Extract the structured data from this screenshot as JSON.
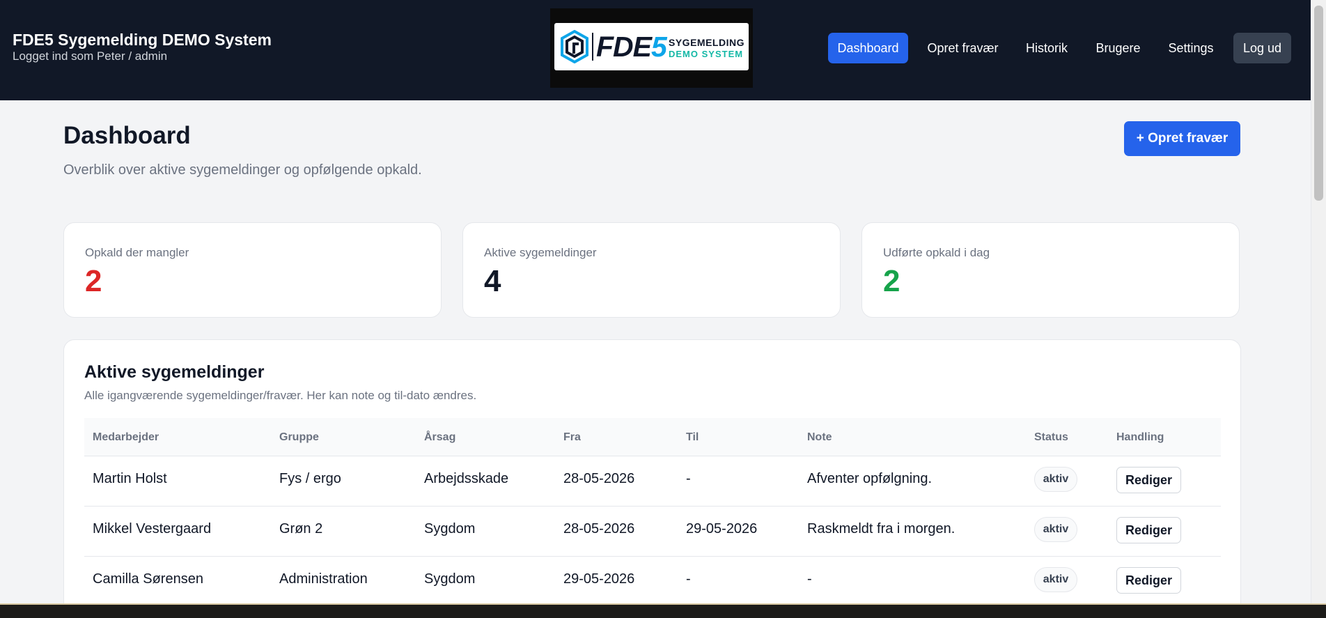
{
  "header": {
    "app_title": "FDE5 Sygemelding DEMO System",
    "logged_in_as": "Logget ind som Peter / admin",
    "logo": {
      "fde": "FDE",
      "five": "5",
      "line1": "SYGEMELDING",
      "line2": "DEMO SYSTEM"
    },
    "nav": [
      {
        "label": "Dashboard",
        "active": true
      },
      {
        "label": "Opret fravær"
      },
      {
        "label": "Historik"
      },
      {
        "label": "Brugere"
      },
      {
        "label": "Settings"
      },
      {
        "label": "Log ud"
      }
    ]
  },
  "page": {
    "title": "Dashboard",
    "subtitle": "Overblik over aktive sygemeldinger og opfølgende opkald.",
    "create_button": "+ Opret fravær"
  },
  "stats": [
    {
      "label": "Opkald der mangler",
      "value": "2",
      "color": "#dc2626"
    },
    {
      "label": "Aktive sygemeldinger",
      "value": "4",
      "color": "#111827"
    },
    {
      "label": "Udførte opkald i dag",
      "value": "2",
      "color": "#16a34a"
    }
  ],
  "panel": {
    "title": "Aktive sygemeldinger",
    "subtitle": "Alle igangværende sygemeldinger/fravær. Her kan note og til-dato ændres.",
    "columns": [
      "Medarbejder",
      "Gruppe",
      "Årsag",
      "Fra",
      "Til",
      "Note",
      "Status",
      "Handling"
    ],
    "rows": [
      {
        "medarbejder": "Martin Holst",
        "gruppe": "Fys / ergo",
        "aarsag": "Arbejdsskade",
        "fra": "28-05-2026",
        "til": "-",
        "note": "Afventer opfølgning.",
        "status": "aktiv",
        "action": "Rediger"
      },
      {
        "medarbejder": "Mikkel Vestergaard",
        "gruppe": "Grøn 2",
        "aarsag": "Sygdom",
        "fra": "28-05-2026",
        "til": "29-05-2026",
        "note": "Raskmeldt fra i morgen.",
        "status": "aktiv",
        "action": "Rediger"
      },
      {
        "medarbejder": "Camilla Sørensen",
        "gruppe": "Administration",
        "aarsag": "Sygdom",
        "fra": "29-05-2026",
        "til": "-",
        "note": "-",
        "status": "aktiv",
        "action": "Rediger"
      }
    ]
  }
}
